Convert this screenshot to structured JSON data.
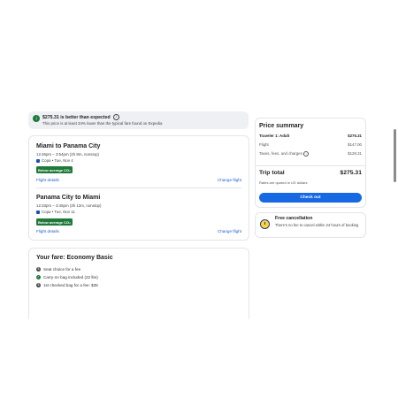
{
  "deal": {
    "headline": "$275.31 is better than expected",
    "subtext": "This price is at least 34% lower than the typical fare found on Expedia"
  },
  "legs": [
    {
      "title": "Miami to Panama City",
      "times": "12:46pm – 3:54pm (2h 8m, nonstop)",
      "airline": "Copa • Tue, Nov 4",
      "badge": "Below average CO₂",
      "details_link": "Flight details",
      "change_link": "Change flight"
    },
    {
      "title": "Panama City to Miami",
      "times": "12:33pm – 3:45pm (3h 12m, nonstop)",
      "airline": "Copa • Tue, Nov 11",
      "badge": "Below average CO₂",
      "details_link": "Flight details",
      "change_link": "Change flight"
    }
  ],
  "fare": {
    "title": "Your fare: Economy Basic",
    "items": [
      {
        "icon": "dollar-icon",
        "text": "Seat choice for a fee"
      },
      {
        "icon": "check-icon",
        "text": "Carry-on bag included (22 lbs)"
      },
      {
        "icon": "dollar-icon",
        "text": "1st checked bag for a fee: $35"
      }
    ]
  },
  "summary": {
    "title": "Price summary",
    "traveler_label": "Traveler 1: Adult",
    "traveler_value": "$275.31",
    "flight_label": "Flight",
    "flight_value": "$147.00",
    "taxes_label": "Taxes, fees, and charges",
    "taxes_value": "$128.31",
    "total_label": "Trip total",
    "total_value": "$275.31",
    "note": "Rates are quoted in US dollars",
    "checkout_label": "Check out"
  },
  "cancellation": {
    "title": "Free cancellation",
    "text": "There's no fee to cancel within 24 hours of booking"
  },
  "colors": {
    "accent": "#1668e3",
    "link": "#1a5fd0",
    "badge": "#1f7a3a",
    "deal_bg": "#eef0f3"
  }
}
